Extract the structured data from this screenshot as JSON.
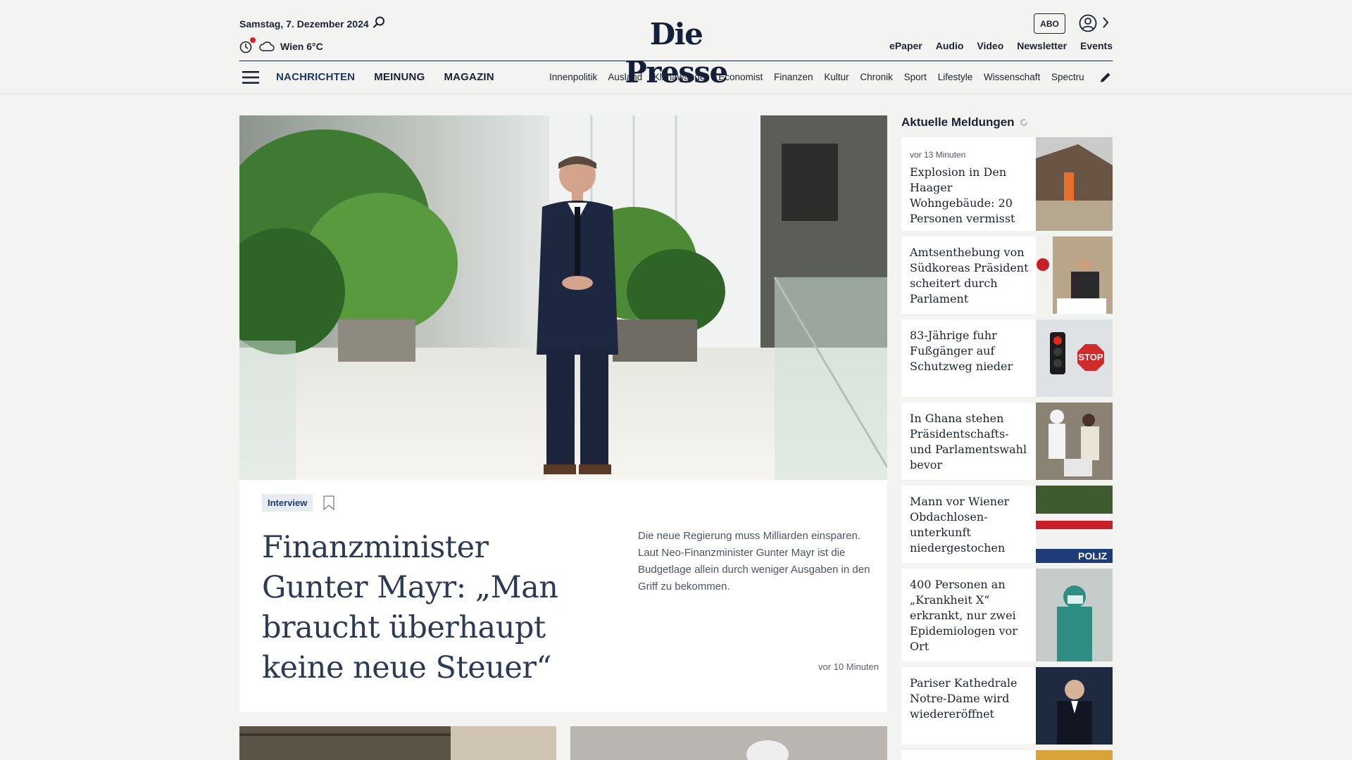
{
  "header": {
    "date": "Samstag, 7. Dezember 2024",
    "weather": "Wien 6°C",
    "logo": "Die Presse",
    "abo_label": "ABO",
    "top_links": [
      "ePaper",
      "Audio",
      "Video",
      "Newsletter",
      "Events"
    ],
    "main_nav": [
      "NACHRICHTEN",
      "MEINUNG",
      "MAGAZIN"
    ],
    "sections": [
      "Innenpolitik",
      "Ausland",
      "Klimawandel",
      "Economist",
      "Finanzen",
      "Kultur",
      "Chronik",
      "Sport",
      "Lifestyle",
      "Wissenschaft",
      "Spectrum"
    ],
    "accent_color": "#1d3a66",
    "notification_color": "#d8232a"
  },
  "hero": {
    "tag": "Interview",
    "headline": "Finanzminister Gunter Mayr: „Man braucht überhaupt keine neue Steuer“",
    "teaser": "Die neue Regierung muss Milliarden einsparen. Laut Neo-Finanzminister Gunter Mayr ist die Budgetlage allein durch weniger Ausgaben in den Griff zu bekommen.",
    "time": "vor 10 Minuten"
  },
  "sidebar": {
    "title": "Aktuelle Meldungen",
    "items": [
      {
        "meta": "vor 13 Minuten",
        "title": "Explosion in Den Haager Wohngebäude: 20 Personen vermisst"
      },
      {
        "meta": "",
        "title": "Amtsenthebung von Südkoreas Präsident scheitert durch Parlament"
      },
      {
        "meta": "",
        "title": "83-Jährige fuhr Fußgänger auf Schutzweg nieder"
      },
      {
        "meta": "",
        "title": "In Ghana stehen Präsidentschafts- und Parlamentswahl bevor"
      },
      {
        "meta": "",
        "title": "Mann vor Wiener Obdachlosen­unterkunft niedergestochen"
      },
      {
        "meta": "",
        "title": "400 Personen an „Krankheit X“ erkrankt, nur zwei Epidemiologen vor Ort"
      },
      {
        "meta": "",
        "title": "Pariser Kathedrale Notre-Dame wird wiedereröffnet"
      }
    ]
  },
  "icons": {
    "search": "search-icon",
    "notification": "notification-icon",
    "weather": "cloud-icon",
    "user": "user-icon",
    "menu": "hamburger-icon",
    "edit": "pencil-icon",
    "bookmark": "bookmark-icon"
  }
}
